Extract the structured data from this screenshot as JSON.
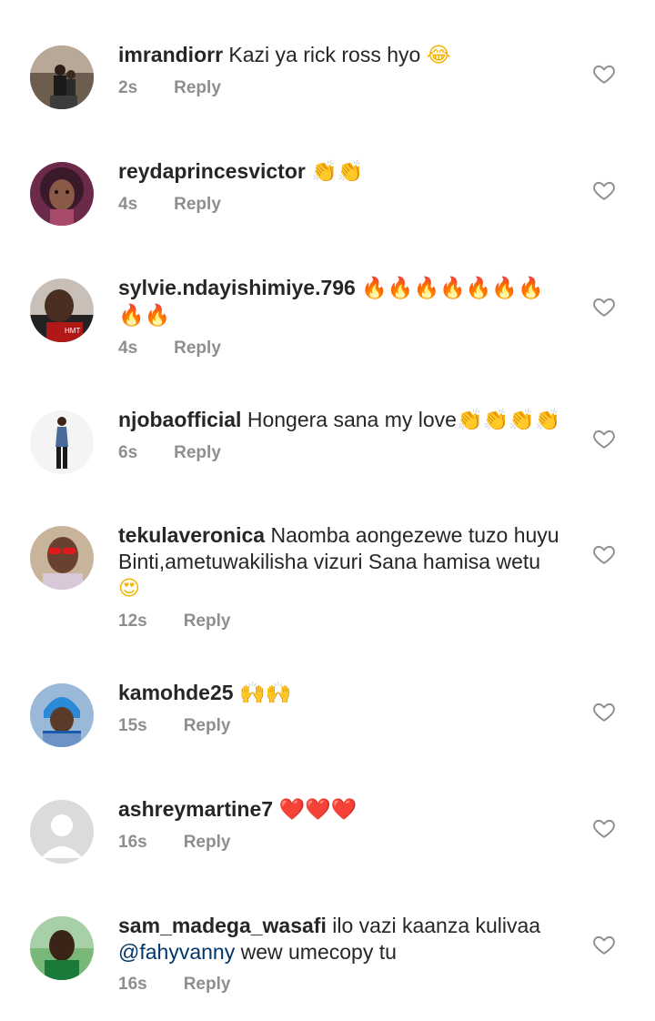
{
  "comments": [
    {
      "username": "imrandiorr",
      "text": "Kazi ya rick ross hyo",
      "emoji": [
        "😂"
      ],
      "time": "2s",
      "reply": "Reply"
    },
    {
      "username": "reydaprincesvictor",
      "text": "",
      "emoji": [
        "👏",
        "👏"
      ],
      "time": "4s",
      "reply": "Reply"
    },
    {
      "username": "sylvie.ndayishimiye.796",
      "text": "",
      "emoji": [
        "🔥",
        "🔥",
        "🔥",
        "🔥",
        "🔥",
        "🔥",
        "🔥",
        "🔥",
        "🔥"
      ],
      "time": "4s",
      "reply": "Reply"
    },
    {
      "username": "njobaofficial",
      "text": "Hongera sana my love",
      "emoji": [
        "👏",
        "👏",
        "👏",
        "👏"
      ],
      "time": "6s",
      "reply": "Reply"
    },
    {
      "username": "tekulaveronica",
      "text": "Naomba aongezewe tuzo huyu Binti,ametuwakilisha vizuri Sana hamisa wetu",
      "emoji": [
        "😍"
      ],
      "time": "12s",
      "reply": "Reply"
    },
    {
      "username": "kamohde25",
      "text": "",
      "emoji": [
        "🙌",
        "🙌"
      ],
      "time": "15s",
      "reply": "Reply"
    },
    {
      "username": "ashreymartine7",
      "text": "",
      "emoji": [
        "❤️",
        "❤️",
        "❤️"
      ],
      "time": "16s",
      "reply": "Reply"
    },
    {
      "username": "sam_madega_wasafi",
      "text": "ilo vazi kaanza kulivaa",
      "mention": "@fahyvanny",
      "text_after": "wew umecopy tu",
      "time": "16s",
      "reply": "Reply"
    }
  ],
  "colors": {
    "text": "#262626",
    "secondary": "#8e8e8e",
    "mention": "#00376b",
    "background": "#ffffff"
  },
  "icons": {
    "like": "heart-outline-icon"
  }
}
